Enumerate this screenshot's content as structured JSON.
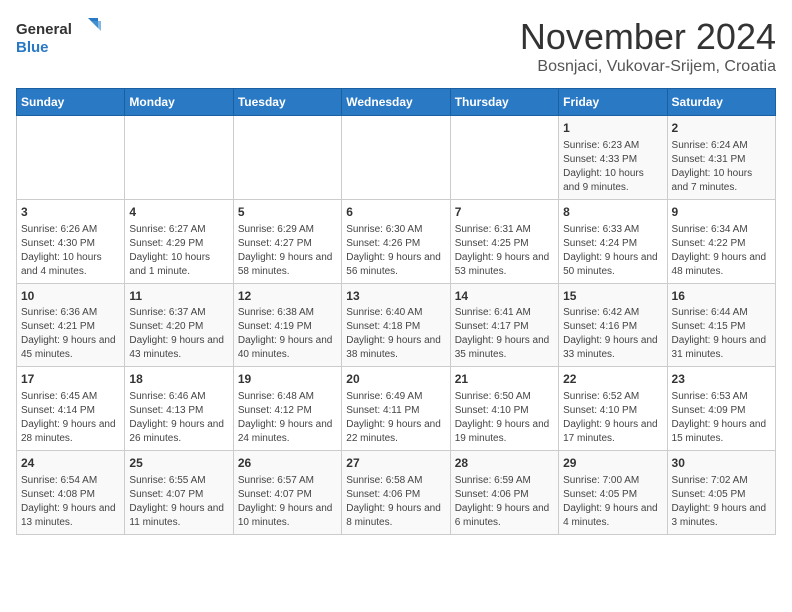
{
  "header": {
    "logo_line1": "General",
    "logo_line2": "Blue",
    "month": "November 2024",
    "location": "Bosnjaci, Vukovar-Srijem, Croatia"
  },
  "days_of_week": [
    "Sunday",
    "Monday",
    "Tuesday",
    "Wednesday",
    "Thursday",
    "Friday",
    "Saturday"
  ],
  "weeks": [
    [
      {
        "day": "",
        "info": ""
      },
      {
        "day": "",
        "info": ""
      },
      {
        "day": "",
        "info": ""
      },
      {
        "day": "",
        "info": ""
      },
      {
        "day": "",
        "info": ""
      },
      {
        "day": "1",
        "info": "Sunrise: 6:23 AM\nSunset: 4:33 PM\nDaylight: 10 hours and 9 minutes."
      },
      {
        "day": "2",
        "info": "Sunrise: 6:24 AM\nSunset: 4:31 PM\nDaylight: 10 hours and 7 minutes."
      }
    ],
    [
      {
        "day": "3",
        "info": "Sunrise: 6:26 AM\nSunset: 4:30 PM\nDaylight: 10 hours and 4 minutes."
      },
      {
        "day": "4",
        "info": "Sunrise: 6:27 AM\nSunset: 4:29 PM\nDaylight: 10 hours and 1 minute."
      },
      {
        "day": "5",
        "info": "Sunrise: 6:29 AM\nSunset: 4:27 PM\nDaylight: 9 hours and 58 minutes."
      },
      {
        "day": "6",
        "info": "Sunrise: 6:30 AM\nSunset: 4:26 PM\nDaylight: 9 hours and 56 minutes."
      },
      {
        "day": "7",
        "info": "Sunrise: 6:31 AM\nSunset: 4:25 PM\nDaylight: 9 hours and 53 minutes."
      },
      {
        "day": "8",
        "info": "Sunrise: 6:33 AM\nSunset: 4:24 PM\nDaylight: 9 hours and 50 minutes."
      },
      {
        "day": "9",
        "info": "Sunrise: 6:34 AM\nSunset: 4:22 PM\nDaylight: 9 hours and 48 minutes."
      }
    ],
    [
      {
        "day": "10",
        "info": "Sunrise: 6:36 AM\nSunset: 4:21 PM\nDaylight: 9 hours and 45 minutes."
      },
      {
        "day": "11",
        "info": "Sunrise: 6:37 AM\nSunset: 4:20 PM\nDaylight: 9 hours and 43 minutes."
      },
      {
        "day": "12",
        "info": "Sunrise: 6:38 AM\nSunset: 4:19 PM\nDaylight: 9 hours and 40 minutes."
      },
      {
        "day": "13",
        "info": "Sunrise: 6:40 AM\nSunset: 4:18 PM\nDaylight: 9 hours and 38 minutes."
      },
      {
        "day": "14",
        "info": "Sunrise: 6:41 AM\nSunset: 4:17 PM\nDaylight: 9 hours and 35 minutes."
      },
      {
        "day": "15",
        "info": "Sunrise: 6:42 AM\nSunset: 4:16 PM\nDaylight: 9 hours and 33 minutes."
      },
      {
        "day": "16",
        "info": "Sunrise: 6:44 AM\nSunset: 4:15 PM\nDaylight: 9 hours and 31 minutes."
      }
    ],
    [
      {
        "day": "17",
        "info": "Sunrise: 6:45 AM\nSunset: 4:14 PM\nDaylight: 9 hours and 28 minutes."
      },
      {
        "day": "18",
        "info": "Sunrise: 6:46 AM\nSunset: 4:13 PM\nDaylight: 9 hours and 26 minutes."
      },
      {
        "day": "19",
        "info": "Sunrise: 6:48 AM\nSunset: 4:12 PM\nDaylight: 9 hours and 24 minutes."
      },
      {
        "day": "20",
        "info": "Sunrise: 6:49 AM\nSunset: 4:11 PM\nDaylight: 9 hours and 22 minutes."
      },
      {
        "day": "21",
        "info": "Sunrise: 6:50 AM\nSunset: 4:10 PM\nDaylight: 9 hours and 19 minutes."
      },
      {
        "day": "22",
        "info": "Sunrise: 6:52 AM\nSunset: 4:10 PM\nDaylight: 9 hours and 17 minutes."
      },
      {
        "day": "23",
        "info": "Sunrise: 6:53 AM\nSunset: 4:09 PM\nDaylight: 9 hours and 15 minutes."
      }
    ],
    [
      {
        "day": "24",
        "info": "Sunrise: 6:54 AM\nSunset: 4:08 PM\nDaylight: 9 hours and 13 minutes."
      },
      {
        "day": "25",
        "info": "Sunrise: 6:55 AM\nSunset: 4:07 PM\nDaylight: 9 hours and 11 minutes."
      },
      {
        "day": "26",
        "info": "Sunrise: 6:57 AM\nSunset: 4:07 PM\nDaylight: 9 hours and 10 minutes."
      },
      {
        "day": "27",
        "info": "Sunrise: 6:58 AM\nSunset: 4:06 PM\nDaylight: 9 hours and 8 minutes."
      },
      {
        "day": "28",
        "info": "Sunrise: 6:59 AM\nSunset: 4:06 PM\nDaylight: 9 hours and 6 minutes."
      },
      {
        "day": "29",
        "info": "Sunrise: 7:00 AM\nSunset: 4:05 PM\nDaylight: 9 hours and 4 minutes."
      },
      {
        "day": "30",
        "info": "Sunrise: 7:02 AM\nSunset: 4:05 PM\nDaylight: 9 hours and 3 minutes."
      }
    ]
  ]
}
